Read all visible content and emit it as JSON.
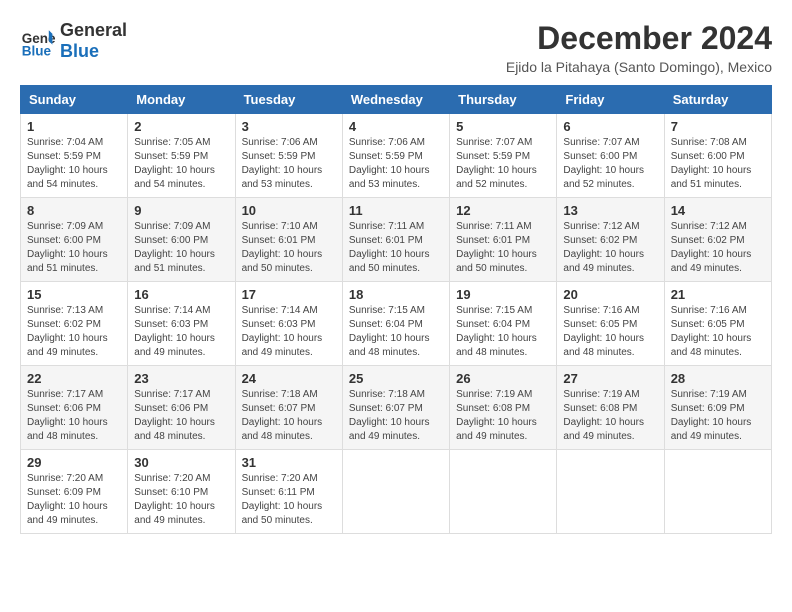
{
  "logo": {
    "line1": "General",
    "line2": "Blue"
  },
  "title": "December 2024",
  "location": "Ejido la Pitahaya (Santo Domingo), Mexico",
  "days_of_week": [
    "Sunday",
    "Monday",
    "Tuesday",
    "Wednesday",
    "Thursday",
    "Friday",
    "Saturday"
  ],
  "weeks": [
    [
      {
        "day": "1",
        "info": "Sunrise: 7:04 AM\nSunset: 5:59 PM\nDaylight: 10 hours\nand 54 minutes."
      },
      {
        "day": "2",
        "info": "Sunrise: 7:05 AM\nSunset: 5:59 PM\nDaylight: 10 hours\nand 54 minutes."
      },
      {
        "day": "3",
        "info": "Sunrise: 7:06 AM\nSunset: 5:59 PM\nDaylight: 10 hours\nand 53 minutes."
      },
      {
        "day": "4",
        "info": "Sunrise: 7:06 AM\nSunset: 5:59 PM\nDaylight: 10 hours\nand 53 minutes."
      },
      {
        "day": "5",
        "info": "Sunrise: 7:07 AM\nSunset: 5:59 PM\nDaylight: 10 hours\nand 52 minutes."
      },
      {
        "day": "6",
        "info": "Sunrise: 7:07 AM\nSunset: 6:00 PM\nDaylight: 10 hours\nand 52 minutes."
      },
      {
        "day": "7",
        "info": "Sunrise: 7:08 AM\nSunset: 6:00 PM\nDaylight: 10 hours\nand 51 minutes."
      }
    ],
    [
      {
        "day": "8",
        "info": "Sunrise: 7:09 AM\nSunset: 6:00 PM\nDaylight: 10 hours\nand 51 minutes."
      },
      {
        "day": "9",
        "info": "Sunrise: 7:09 AM\nSunset: 6:00 PM\nDaylight: 10 hours\nand 51 minutes."
      },
      {
        "day": "10",
        "info": "Sunrise: 7:10 AM\nSunset: 6:01 PM\nDaylight: 10 hours\nand 50 minutes."
      },
      {
        "day": "11",
        "info": "Sunrise: 7:11 AM\nSunset: 6:01 PM\nDaylight: 10 hours\nand 50 minutes."
      },
      {
        "day": "12",
        "info": "Sunrise: 7:11 AM\nSunset: 6:01 PM\nDaylight: 10 hours\nand 50 minutes."
      },
      {
        "day": "13",
        "info": "Sunrise: 7:12 AM\nSunset: 6:02 PM\nDaylight: 10 hours\nand 49 minutes."
      },
      {
        "day": "14",
        "info": "Sunrise: 7:12 AM\nSunset: 6:02 PM\nDaylight: 10 hours\nand 49 minutes."
      }
    ],
    [
      {
        "day": "15",
        "info": "Sunrise: 7:13 AM\nSunset: 6:02 PM\nDaylight: 10 hours\nand 49 minutes."
      },
      {
        "day": "16",
        "info": "Sunrise: 7:14 AM\nSunset: 6:03 PM\nDaylight: 10 hours\nand 49 minutes."
      },
      {
        "day": "17",
        "info": "Sunrise: 7:14 AM\nSunset: 6:03 PM\nDaylight: 10 hours\nand 49 minutes."
      },
      {
        "day": "18",
        "info": "Sunrise: 7:15 AM\nSunset: 6:04 PM\nDaylight: 10 hours\nand 48 minutes."
      },
      {
        "day": "19",
        "info": "Sunrise: 7:15 AM\nSunset: 6:04 PM\nDaylight: 10 hours\nand 48 minutes."
      },
      {
        "day": "20",
        "info": "Sunrise: 7:16 AM\nSunset: 6:05 PM\nDaylight: 10 hours\nand 48 minutes."
      },
      {
        "day": "21",
        "info": "Sunrise: 7:16 AM\nSunset: 6:05 PM\nDaylight: 10 hours\nand 48 minutes."
      }
    ],
    [
      {
        "day": "22",
        "info": "Sunrise: 7:17 AM\nSunset: 6:06 PM\nDaylight: 10 hours\nand 48 minutes."
      },
      {
        "day": "23",
        "info": "Sunrise: 7:17 AM\nSunset: 6:06 PM\nDaylight: 10 hours\nand 48 minutes."
      },
      {
        "day": "24",
        "info": "Sunrise: 7:18 AM\nSunset: 6:07 PM\nDaylight: 10 hours\nand 48 minutes."
      },
      {
        "day": "25",
        "info": "Sunrise: 7:18 AM\nSunset: 6:07 PM\nDaylight: 10 hours\nand 49 minutes."
      },
      {
        "day": "26",
        "info": "Sunrise: 7:19 AM\nSunset: 6:08 PM\nDaylight: 10 hours\nand 49 minutes."
      },
      {
        "day": "27",
        "info": "Sunrise: 7:19 AM\nSunset: 6:08 PM\nDaylight: 10 hours\nand 49 minutes."
      },
      {
        "day": "28",
        "info": "Sunrise: 7:19 AM\nSunset: 6:09 PM\nDaylight: 10 hours\nand 49 minutes."
      }
    ],
    [
      {
        "day": "29",
        "info": "Sunrise: 7:20 AM\nSunset: 6:09 PM\nDaylight: 10 hours\nand 49 minutes."
      },
      {
        "day": "30",
        "info": "Sunrise: 7:20 AM\nSunset: 6:10 PM\nDaylight: 10 hours\nand 49 minutes."
      },
      {
        "day": "31",
        "info": "Sunrise: 7:20 AM\nSunset: 6:11 PM\nDaylight: 10 hours\nand 50 minutes."
      },
      {
        "day": "",
        "info": ""
      },
      {
        "day": "",
        "info": ""
      },
      {
        "day": "",
        "info": ""
      },
      {
        "day": "",
        "info": ""
      }
    ]
  ]
}
